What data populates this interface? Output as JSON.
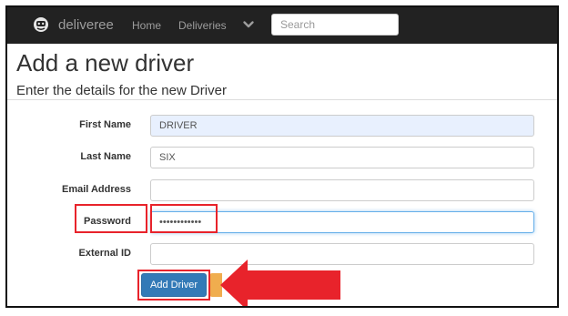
{
  "nav": {
    "brand": "deliveree",
    "links": [
      "Home",
      "Deliveries"
    ],
    "search_placeholder": "Search"
  },
  "page": {
    "title": "Add a new driver",
    "subtitle": "Enter the details for the new Driver"
  },
  "form": {
    "fields": [
      {
        "label": "First Name",
        "value": "DRIVER"
      },
      {
        "label": "Last Name",
        "value": "SIX"
      },
      {
        "label": "Email Address",
        "value": ""
      },
      {
        "label": "Password",
        "value": "••••••••••••"
      },
      {
        "label": "External ID",
        "value": ""
      }
    ],
    "submit_label": "Add Driver"
  },
  "icons": {
    "brand": "avatar-icon",
    "nav_dropdown": "chevron-down-icon"
  },
  "colors": {
    "navbar": "#222222",
    "primary": "#337ab7",
    "highlight": "#e8232b",
    "warning": "#f0ad4e"
  }
}
